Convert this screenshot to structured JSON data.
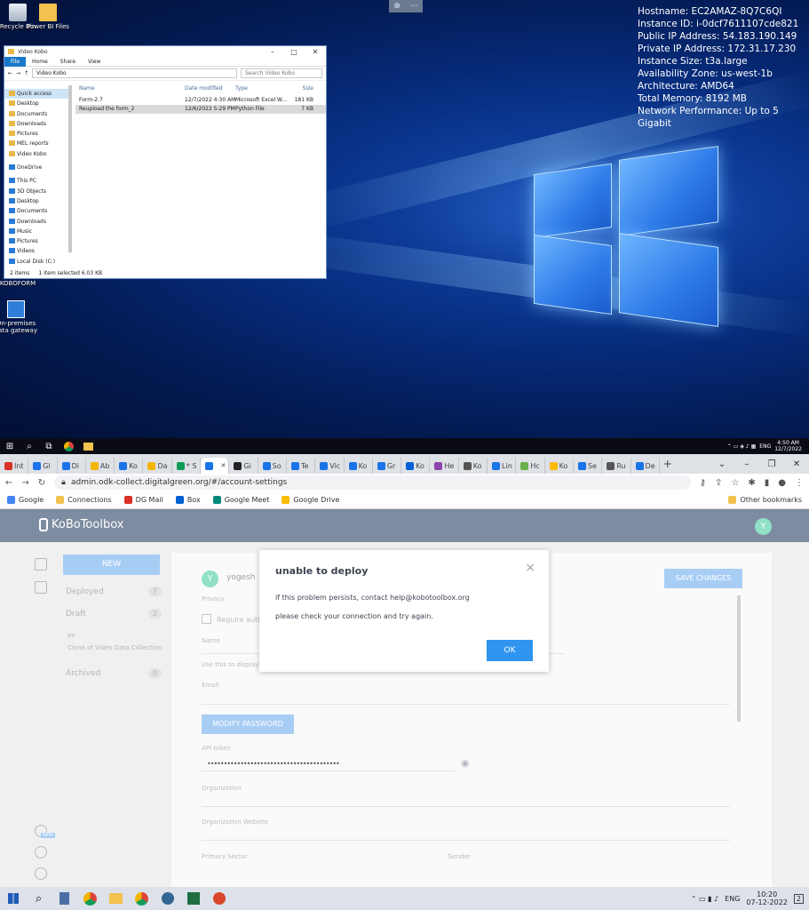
{
  "remote_desktop": {
    "icons": [
      {
        "label": "Recycle Bin",
        "icon": "recycle-bin-icon"
      },
      {
        "label": "Power BI Files",
        "icon": "folder-icon"
      },
      {
        "label": "KOBOFORM",
        "icon": "folder-icon"
      },
      {
        "label": "On-premises data gateway",
        "icon": "cloud-gateway-icon"
      }
    ],
    "sysinfo": [
      "Hostname: EC2AMAZ-8Q7C6QI",
      "Instance ID: i-0dcf7611107cde821",
      "Public IP Address: 54.183.190.149",
      "Private IP Address: 172.31.17.230",
      "Instance Size: t3a.large",
      "Availability Zone: us-west-1b",
      "Architecture: AMD64",
      "Total Memory: 8192 MB",
      "Network Performance: Up to 5 Gigabit"
    ],
    "explorer": {
      "title": "Video Kobo",
      "ribbon": [
        "File",
        "Home",
        "Share",
        "View"
      ],
      "path": "Video Kobo",
      "search_placeholder": "Search Video Kobo",
      "nav": [
        {
          "label": "Quick access",
          "selected": true
        },
        {
          "label": "Desktop"
        },
        {
          "label": "Documents"
        },
        {
          "label": "Downloads"
        },
        {
          "label": "Pictures"
        },
        {
          "label": "MEL reports"
        },
        {
          "label": "Video Kobo"
        },
        {
          "label": "OneDrive",
          "blue": true,
          "gap": true
        },
        {
          "label": "This PC",
          "blue": true,
          "gap": true
        },
        {
          "label": "3D Objects",
          "blue": true
        },
        {
          "label": "Desktop",
          "blue": true
        },
        {
          "label": "Documents",
          "blue": true
        },
        {
          "label": "Downloads",
          "blue": true
        },
        {
          "label": "Music",
          "blue": true
        },
        {
          "label": "Pictures",
          "blue": true
        },
        {
          "label": "Videos",
          "blue": true
        },
        {
          "label": "Local Disk (C:)",
          "blue": true
        }
      ],
      "columns": [
        "Name",
        "Date modified",
        "Type",
        "Size"
      ],
      "files": [
        {
          "name": "Form-2.7",
          "date": "12/7/2022 4:30 AM",
          "type": "Microsoft Excel W...",
          "size": "181 KB"
        },
        {
          "name": "Reupload the form_2",
          "date": "12/6/2022 5:29 PM",
          "type": "Python File",
          "size": "7 KB"
        }
      ],
      "status_items": "2 items",
      "status_selected": "1 item selected  6.03 KB"
    },
    "taskbar": {
      "lang": "ENG",
      "time": "4:50 AM",
      "date": "12/7/2022"
    }
  },
  "browser": {
    "tabs": [
      "Int",
      "Gl",
      "Di",
      "Ab",
      "Ko",
      "Da",
      "* S",
      "",
      "Gi",
      "So",
      "Te",
      "Vic",
      "Ko",
      "Gr",
      "Ko",
      "He",
      "Ko",
      "Lin",
      "Hc",
      "Ko",
      "Se",
      "Ru",
      "De"
    ],
    "active_tab_index": 7,
    "url": "admin.odk-collect.digitalgreen.org/#/account-settings",
    "bookmarks": [
      "Google",
      "Connections",
      "DG Mail",
      "Box",
      "Google Meet",
      "Google Drive"
    ],
    "other_bookmarks": "Other bookmarks"
  },
  "kobo": {
    "logo": "KoBoToolbox",
    "avatar": "Y",
    "new_button": "NEW",
    "sidebar": [
      {
        "label": "Deployed",
        "count": "7"
      },
      {
        "label": "Draft",
        "count": "2"
      },
      {
        "label": "Archived",
        "count": "0"
      }
    ],
    "sidebar_sub": "es",
    "sidebar_sub2": "Clone of Video Data Collection",
    "username": "yogesh",
    "save_button": "SAVE CHANGES",
    "fields": {
      "privacy": "Privacy",
      "require_auth": "Require authe",
      "name": "Name",
      "name_hint": "Use this to display y",
      "email": "Email",
      "modify_password": "MODIFY PASSWORD",
      "api_token": "API token",
      "token_mask": "••••••••••••••••••••••••••••••••••••••••",
      "organization": "Organization",
      "organization_website": "Organization Website",
      "primary_sector": "Primary Sector",
      "gender": "Gender"
    },
    "help_badge": "NEW"
  },
  "modal": {
    "title": "unable to deploy",
    "line1": "if this problem persists, contact help@kobotoolbox.org",
    "line2": "please check your connection and try again.",
    "ok": "OK",
    "close": "×"
  },
  "local_taskbar": {
    "lang": "ENG",
    "time": "10:20",
    "date": "07-12-2022",
    "notif_count": "2"
  }
}
